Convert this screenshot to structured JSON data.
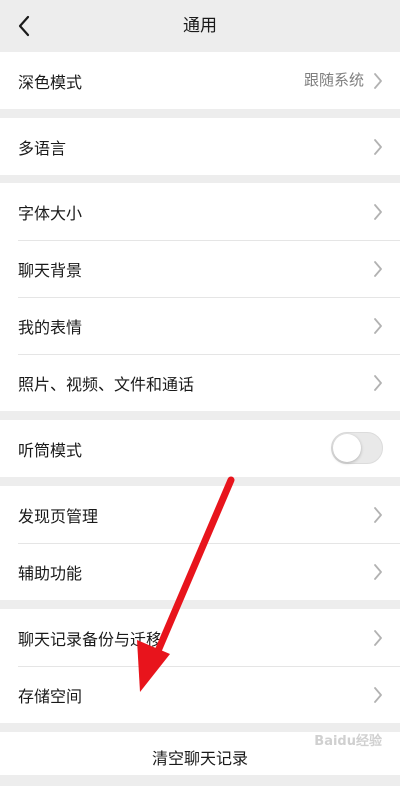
{
  "header": {
    "title": "通用"
  },
  "groups": [
    {
      "items": [
        {
          "label": "深色模式",
          "value": "跟随系统"
        }
      ]
    },
    {
      "items": [
        {
          "label": "多语言"
        }
      ]
    },
    {
      "items": [
        {
          "label": "字体大小"
        },
        {
          "label": "聊天背景"
        },
        {
          "label": "我的表情"
        },
        {
          "label": "照片、视频、文件和通话"
        }
      ]
    },
    {
      "items": [
        {
          "label": "听筒模式",
          "toggle": false
        }
      ]
    },
    {
      "items": [
        {
          "label": "发现页管理"
        },
        {
          "label": "辅助功能"
        }
      ]
    },
    {
      "items": [
        {
          "label": "聊天记录备份与迁移"
        },
        {
          "label": "存储空间"
        }
      ]
    }
  ],
  "clear_button": {
    "label": "清空聊天记录"
  },
  "watermark": "Baidu经验",
  "colors": {
    "annotation_arrow": "#e8141c"
  }
}
